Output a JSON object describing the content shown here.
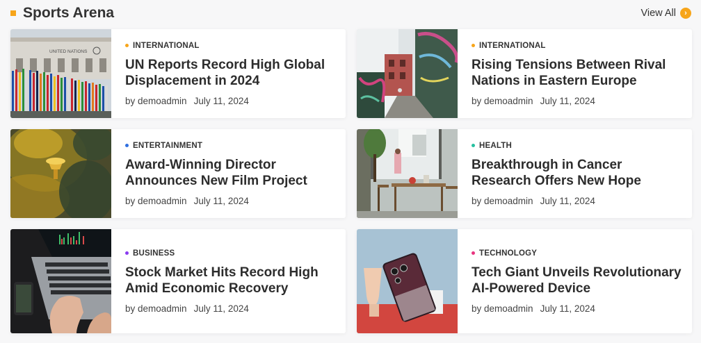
{
  "section": {
    "title": "Sports Arena",
    "view_all_label": "View All",
    "accent_color": "#f7a51a"
  },
  "articles": [
    {
      "category": "INTERNATIONAL",
      "category_color": "#f7a51a",
      "title": "UN Reports Record High Global Displacement in 2024",
      "author": "by demoadmin",
      "date": "July 11, 2024",
      "image_sign": "UNITED NATIONS"
    },
    {
      "category": "INTERNATIONAL",
      "category_color": "#f7a51a",
      "title": "Rising Tensions Between Rival Nations in Eastern Europe",
      "author": "by demoadmin",
      "date": "July 11, 2024"
    },
    {
      "category": "ENTERTAINMENT",
      "category_color": "#2f6fe0",
      "title": "Award-Winning Director Announces New Film Project",
      "author": "by demoadmin",
      "date": "July 11, 2024"
    },
    {
      "category": "HEALTH",
      "category_color": "#27c0a0",
      "title": "Breakthrough in Cancer Research Offers New Hope",
      "author": "by demoadmin",
      "date": "July 11, 2024"
    },
    {
      "category": "BUSINESS",
      "category_color": "#8a3cf0",
      "title": "Stock Market Hits Record High Amid Economic Recovery",
      "author": "by demoadmin",
      "date": "July 11, 2024"
    },
    {
      "category": "TECHNOLOGY",
      "category_color": "#e8357f",
      "title": "Tech Giant Unveils Revolutionary AI-Powered Device",
      "author": "by demoadmin",
      "date": "July 11, 2024"
    }
  ]
}
